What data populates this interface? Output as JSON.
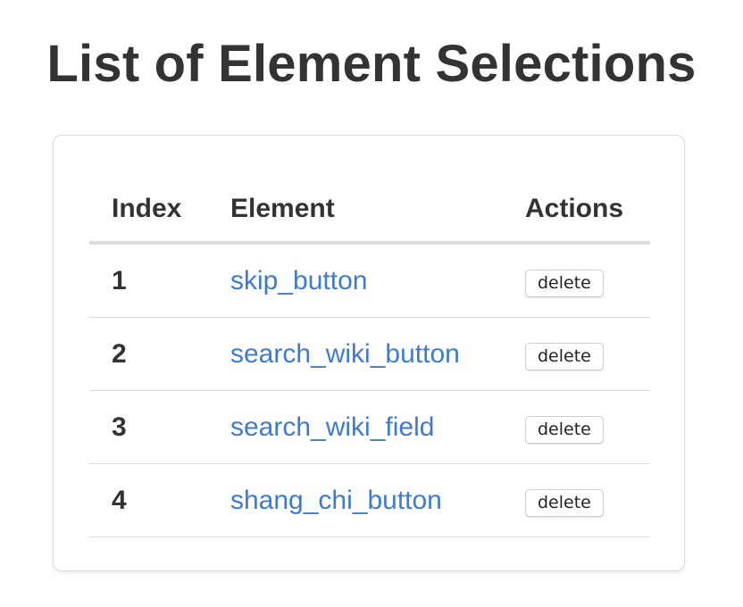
{
  "title": "List of Element Selections",
  "table": {
    "headers": {
      "index": "Index",
      "element": "Element",
      "actions": "Actions"
    },
    "rows": [
      {
        "index": "1",
        "element": "skip_button",
        "action": "delete"
      },
      {
        "index": "2",
        "element": "search_wiki_button",
        "action": "delete"
      },
      {
        "index": "3",
        "element": "search_wiki_field",
        "action": "delete"
      },
      {
        "index": "4",
        "element": "shang_chi_button",
        "action": "delete"
      }
    ]
  },
  "colors": {
    "text": "#333333",
    "link": "#3d7bd0",
    "border": "#dddddd"
  }
}
